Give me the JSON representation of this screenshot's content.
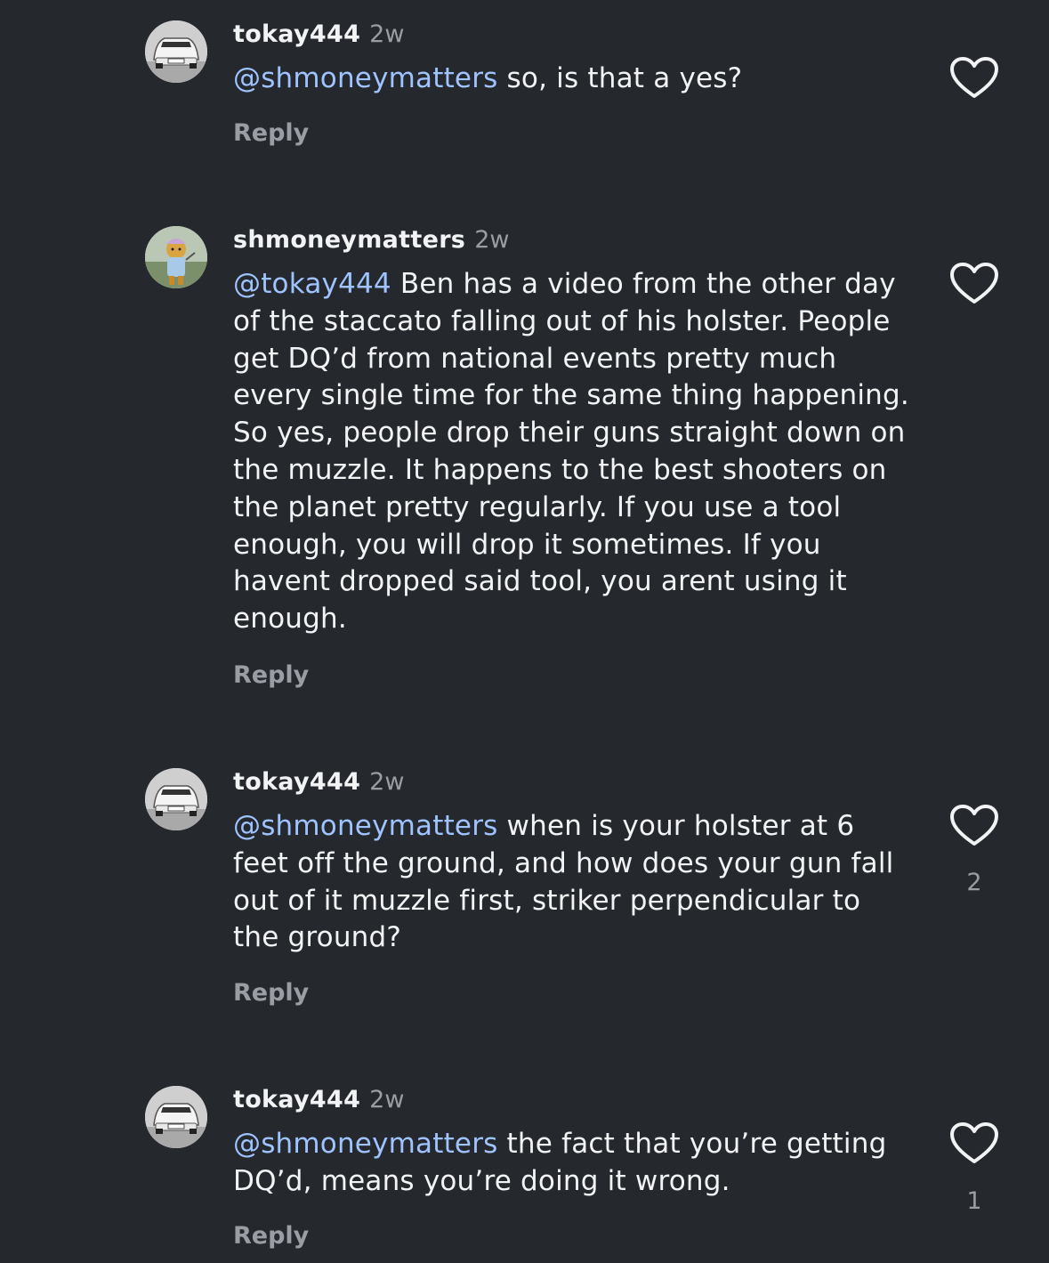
{
  "comments": [
    {
      "username": "tokay444",
      "time": "2w",
      "mention": "@shmoneymatters",
      "text": " so, is that a yes?",
      "reply_label": "Reply",
      "like_count": "",
      "avatar_icon": "car-avatar"
    },
    {
      "username": "shmoneymatters",
      "time": "2w",
      "mention": "@tokay444",
      "text": " Ben has a video from the other day of the staccato falling out of his holster. People get DQ’d from national events pretty much every single time for the same thing happening. So yes, people drop their guns straight down on the muzzle. It happens to the best shooters on the planet pretty regularly. If you use a tool enough, you will drop it sometimes. If you havent dropped said tool, you arent using it enough.",
      "reply_label": "Reply",
      "like_count": "",
      "avatar_icon": "cartoon-bear-avatar"
    },
    {
      "username": "tokay444",
      "time": "2w",
      "mention": "@shmoneymatters",
      "text": " when is your holster at 6 feet off the ground, and how does your gun fall out of it muzzle first, striker perpendicular to the ground?",
      "reply_label": "Reply",
      "like_count": "2",
      "avatar_icon": "car-avatar"
    },
    {
      "username": "tokay444",
      "time": "2w",
      "mention": "@shmoneymatters",
      "text": " the fact that you’re getting DQ’d, means you’re doing it wrong.",
      "reply_label": "Reply",
      "like_count": "1",
      "avatar_icon": "car-avatar"
    }
  ],
  "colors": {
    "background": "#25282d",
    "mention": "#9ec3ff",
    "secondary_text": "#9a9da3",
    "primary_text": "#f2f3f5"
  },
  "icons": {
    "like": "heart-outline-icon"
  }
}
